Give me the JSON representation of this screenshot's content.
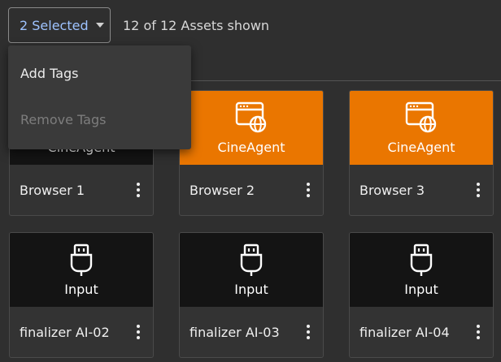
{
  "toolbar": {
    "selected_label": "2 Selected",
    "count_label": "12 of 12 Assets shown"
  },
  "menu": {
    "items": [
      {
        "label": "Add Tags",
        "enabled": true
      },
      {
        "label": "Remove Tags",
        "enabled": false
      }
    ]
  },
  "colors": {
    "accent": "#ea7600",
    "selected_text": "#9ec3ff"
  },
  "assets": [
    {
      "type_label": "CineAgent",
      "name": "Browser 1",
      "icon": "browser-globe-icon"
    },
    {
      "type_label": "CineAgent",
      "name": "Browser 2",
      "icon": "browser-globe-icon"
    },
    {
      "type_label": "CineAgent",
      "name": "Browser 3",
      "icon": "browser-globe-icon"
    },
    {
      "type_label": "Input",
      "name": "finalizer AI-02",
      "icon": "usb-plug-icon"
    },
    {
      "type_label": "Input",
      "name": "finalizer AI-03",
      "icon": "usb-plug-icon"
    },
    {
      "type_label": "Input",
      "name": "finalizer AI-04",
      "icon": "usb-plug-icon"
    }
  ]
}
